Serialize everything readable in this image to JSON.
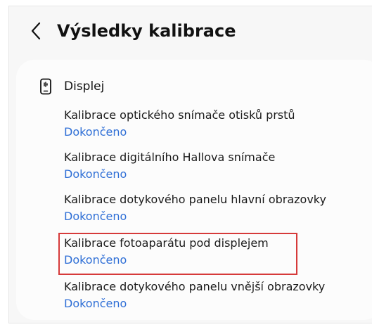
{
  "header": {
    "back_label": "<",
    "title": "Výsledky kalibrace"
  },
  "section": {
    "icon": "phone-icon",
    "title": "Displej"
  },
  "items": [
    {
      "title": "Kalibrace optického snímače otisků prstů",
      "status": "Dokončeno"
    },
    {
      "title": "Kalibrace digitálního Hallova snímače",
      "status": "Dokončeno"
    },
    {
      "title": "Kalibrace dotykového panelu hlavní obrazovky",
      "status": "Dokončeno"
    },
    {
      "title": "Kalibrace fotoaparátu pod displejem",
      "status": "Dokončeno"
    },
    {
      "title": "Kalibrace dotykového panelu vnější obrazovky",
      "status": "Dokončeno"
    }
  ],
  "highlight": {
    "color": "#d63a3a",
    "target_item": "Kalibrace fotoaparátu pod displejem"
  },
  "colors": {
    "status": "#2f6fd6",
    "background": "#f7f7f7",
    "card": "#fcfcfc"
  }
}
